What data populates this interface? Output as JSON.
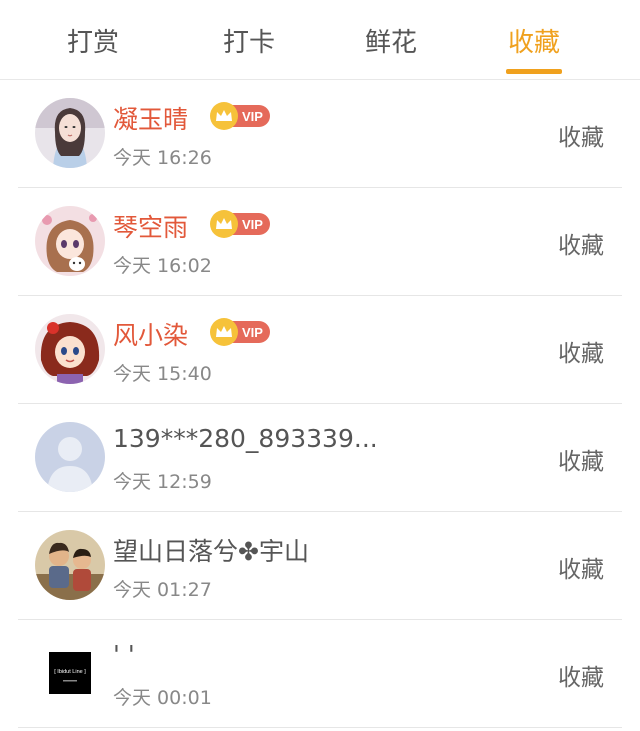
{
  "tabs": [
    {
      "label": "打赏"
    },
    {
      "label": "打卡"
    },
    {
      "label": "鲜花"
    },
    {
      "label": "收藏"
    }
  ],
  "active_tab": "收藏",
  "colors": {
    "accent": "#f0a11e",
    "vip_name": "#e2583a",
    "vip_tag": "#e56a5a"
  },
  "vip_label": "VIP",
  "action_label": "收藏",
  "items": [
    {
      "name": "凝玉晴",
      "vip": true,
      "time": "今天 16:26",
      "avatar": "girl-avatar"
    },
    {
      "name": "琴空雨",
      "vip": true,
      "time": "今天 16:02",
      "avatar": "anime-girl-avatar"
    },
    {
      "name": "风小染",
      "vip": true,
      "time": "今天 15:40",
      "avatar": "cartoon-girl-avatar"
    },
    {
      "name": "139***280_893339...",
      "vip": false,
      "time": "今天 12:59",
      "avatar": "default-user-avatar"
    },
    {
      "name": "望山日落兮✤宇山",
      "vip": false,
      "time": "今天 01:27",
      "avatar": "children-photo-avatar"
    },
    {
      "name": "' '",
      "vip": false,
      "time": "今天 00:01",
      "avatar": "black-logo-avatar"
    }
  ],
  "logo_text": "[ Ibidut Line ]"
}
